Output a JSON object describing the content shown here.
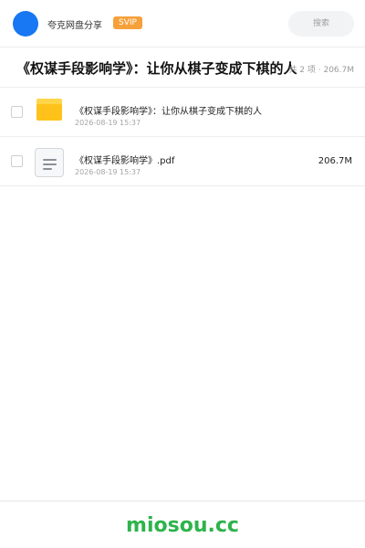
{
  "header": {
    "brand_name": "夸克网盘分享",
    "badge": "SVIP",
    "search_placeholder": "搜索"
  },
  "folder": {
    "title": "《权谋手段影响学》：让你从棋子变成下棋的人",
    "summary": "共 2 项 · 206.7M"
  },
  "files": [
    {
      "name": "《权谋手段影响学》：让你从棋子变成下棋的人",
      "date": "2026-08-19 15:37",
      "size": ""
    },
    {
      "name": "《权谋手段影响学》.pdf",
      "date": "2026-08-19 15:37",
      "size": "206.7M"
    }
  ],
  "footer": {
    "brand": "miosou.cc"
  },
  "colors": {
    "accent": "#1877f2",
    "badge": "#f6a03a",
    "folder": "#ffc21a",
    "footer_brand": "#2db34a"
  },
  "icons": {
    "folder": "folder-icon",
    "file": "pdf-file-icon"
  }
}
